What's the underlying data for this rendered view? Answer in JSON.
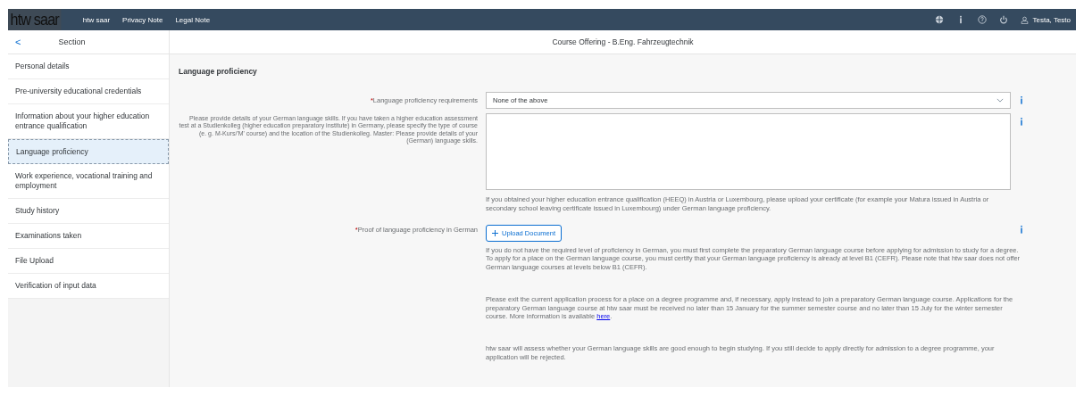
{
  "top_bar": {
    "logo": "htw saar",
    "links": [
      "htw saar",
      "Privacy Note",
      "Legal Note"
    ],
    "user": "Testa, Testo"
  },
  "sidebar": {
    "back": "<",
    "title": "Section",
    "items": [
      {
        "label": "Personal details",
        "selected": false
      },
      {
        "label": "Pre-university educational credentials",
        "selected": false
      },
      {
        "label": "Information about your higher education entrance qualification",
        "selected": false
      },
      {
        "label": "Language proficiency",
        "selected": true
      },
      {
        "label": "Work experience, vocational training and employment",
        "selected": false
      },
      {
        "label": "Study history",
        "selected": false
      },
      {
        "label": "Examinations taken",
        "selected": false
      },
      {
        "label": "File Upload",
        "selected": false
      },
      {
        "label": "Verification of input data",
        "selected": false
      }
    ]
  },
  "page_title": "Course Offering - B.Eng. Fahrzeugtechnik",
  "section_title": "Language proficiency",
  "form": [
    {
      "kind": "select",
      "label": "Language proficiency requirements",
      "required_mark": "*",
      "value": "None of the above"
    },
    {
      "kind": "textarea",
      "label": "Please provide details of your German language skills. If you have taken a higher education assessment test at a Studienkolleg (higher education preparatory institute) in Germany, please specify the type of course (e. g. M-Kurs/'M' course) and the location of the Studienkolleg. Master: Please provide details of your (German) language skills.",
      "note": "If you obtained your higher education entrance qualification (HEEQ) in Austria or Luxembourg, please upload your certificate (for example your Matura issued in Austria or secondary school leaving certificate issued in Luxembourg) under German language proficiency."
    },
    {
      "kind": "upload",
      "label": "Proof of language proficiency in German",
      "required_mark": "*",
      "button": "Upload Document"
    }
  ],
  "paragraphs": [
    {
      "text": "If you do not have the required level of proficiency in German, you must first complete the preparatory German language course before applying for admission to study for a degree. To apply for a place on the German language course, you must certify that your German language proficiency is already at level B1 (CEFR). Please note that htw saar does not offer German language courses at levels below B1 (CEFR)."
    },
    {
      "text": "Please exit the current application process for a place on a degree programme and, if necessary, apply instead to join a preparatory German language course. Applications for the preparatory German language course at htw saar must be received no later than 15 January for the summer semester course and no later than 15 July for the winter semester course. More information is available ",
      "link": "here",
      "after": "."
    },
    {
      "text": "htw saar will assess whether your German language skills are good enough to begin studying. If you still decide to apply directly for admission to a degree programme, your application will be rejected."
    }
  ]
}
